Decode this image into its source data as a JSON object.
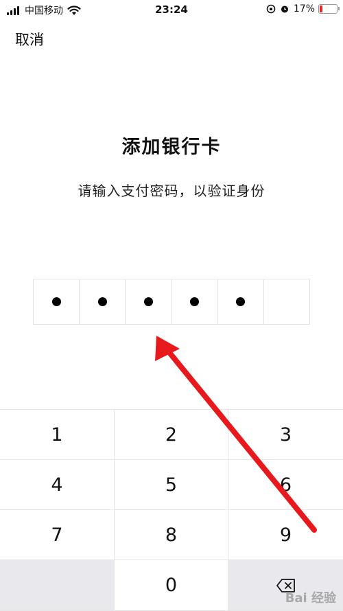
{
  "status_bar": {
    "carrier": "中国移动",
    "time": "23:24",
    "battery": "17%",
    "battery_level": 0.17,
    "icons": [
      "signal-icon",
      "wifi-icon",
      "orientation-lock-icon",
      "alarm-icon",
      "battery-icon"
    ]
  },
  "header": {
    "cancel_label": "取消"
  },
  "main": {
    "title": "添加银行卡",
    "subtitle": "请输入支付密码，以验证身份",
    "pin_filled": 5,
    "pin_length": 6
  },
  "keypad": {
    "keys": [
      "1",
      "2",
      "3",
      "4",
      "5",
      "6",
      "7",
      "8",
      "9",
      "",
      "0",
      "delete"
    ]
  },
  "overlay": {
    "arrow_color": "#e8191c",
    "watermark": "Bai 经验"
  },
  "colors": {
    "dot": "#000000",
    "key_gray": "#e9e8ed",
    "border": "#e3e3e3"
  }
}
